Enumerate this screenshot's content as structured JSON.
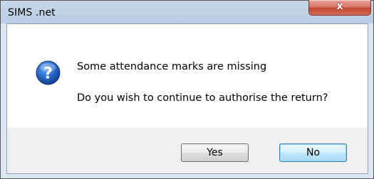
{
  "window": {
    "title": "SIMS .net",
    "close_glyph": "x"
  },
  "message": {
    "icon": "question-icon",
    "line1": "Some attendance marks are missing",
    "line2": "Do you wish to continue to authorise the return?"
  },
  "buttons": {
    "yes": "Yes",
    "no": "No"
  },
  "colors": {
    "icon_blue": "#1f5fbf",
    "default_button_border": "#3c7fb1",
    "close_button": "#c24a35"
  }
}
